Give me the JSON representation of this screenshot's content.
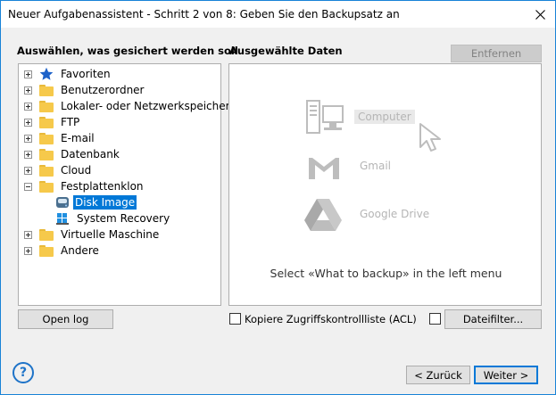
{
  "window": {
    "title": "Neuer Aufgabenassistent - Schritt 2 von 8: Geben Sie den Backupsatz an"
  },
  "left_panel": {
    "heading": "Auswählen, was gesichert werden soll",
    "items": [
      {
        "label": "Favoriten",
        "icon": "star-icon",
        "expander": "plus"
      },
      {
        "label": "Benutzerordner",
        "icon": "folder-icon",
        "expander": "plus"
      },
      {
        "label": "Lokaler- oder Netzwerkspeicher",
        "icon": "folder-icon",
        "expander": "plus"
      },
      {
        "label": "FTP",
        "icon": "folder-icon",
        "expander": "plus"
      },
      {
        "label": "E-mail",
        "icon": "folder-icon",
        "expander": "plus"
      },
      {
        "label": "Datenbank",
        "icon": "folder-icon",
        "expander": "plus"
      },
      {
        "label": "Cloud",
        "icon": "folder-icon",
        "expander": "plus"
      },
      {
        "label": "Festplattenklon",
        "icon": "folder-icon",
        "expander": "minus"
      },
      {
        "label": "Disk Image",
        "icon": "disk-icon",
        "selected": true
      },
      {
        "label": "System Recovery",
        "icon": "system-recovery-icon"
      },
      {
        "label": "Virtuelle Maschine",
        "icon": "folder-icon",
        "expander": "plus"
      },
      {
        "label": "Andere",
        "icon": "folder-icon",
        "expander": "plus"
      }
    ],
    "open_log_label": "Open log"
  },
  "right_panel": {
    "heading": "Ausgewählte Daten",
    "remove_label": "Entfernen",
    "sources": [
      {
        "label": "Computer",
        "icon": "computer-icon"
      },
      {
        "label": "Gmail",
        "icon": "gmail-icon"
      },
      {
        "label": "Google Drive",
        "icon": "google-drive-icon"
      }
    ],
    "hint": "Select «What to backup» in the left menu",
    "acl_label": "Kopiere Zugriffskontrollliste (ACL)",
    "file_filter_label": "Dateifilter..."
  },
  "footer": {
    "help_symbol": "?",
    "back_label": "< Zurück",
    "next_label": "Weiter >"
  },
  "colors": {
    "accent": "#0078d7",
    "folder": "#f6c94b",
    "window_border": "#1883d7"
  }
}
